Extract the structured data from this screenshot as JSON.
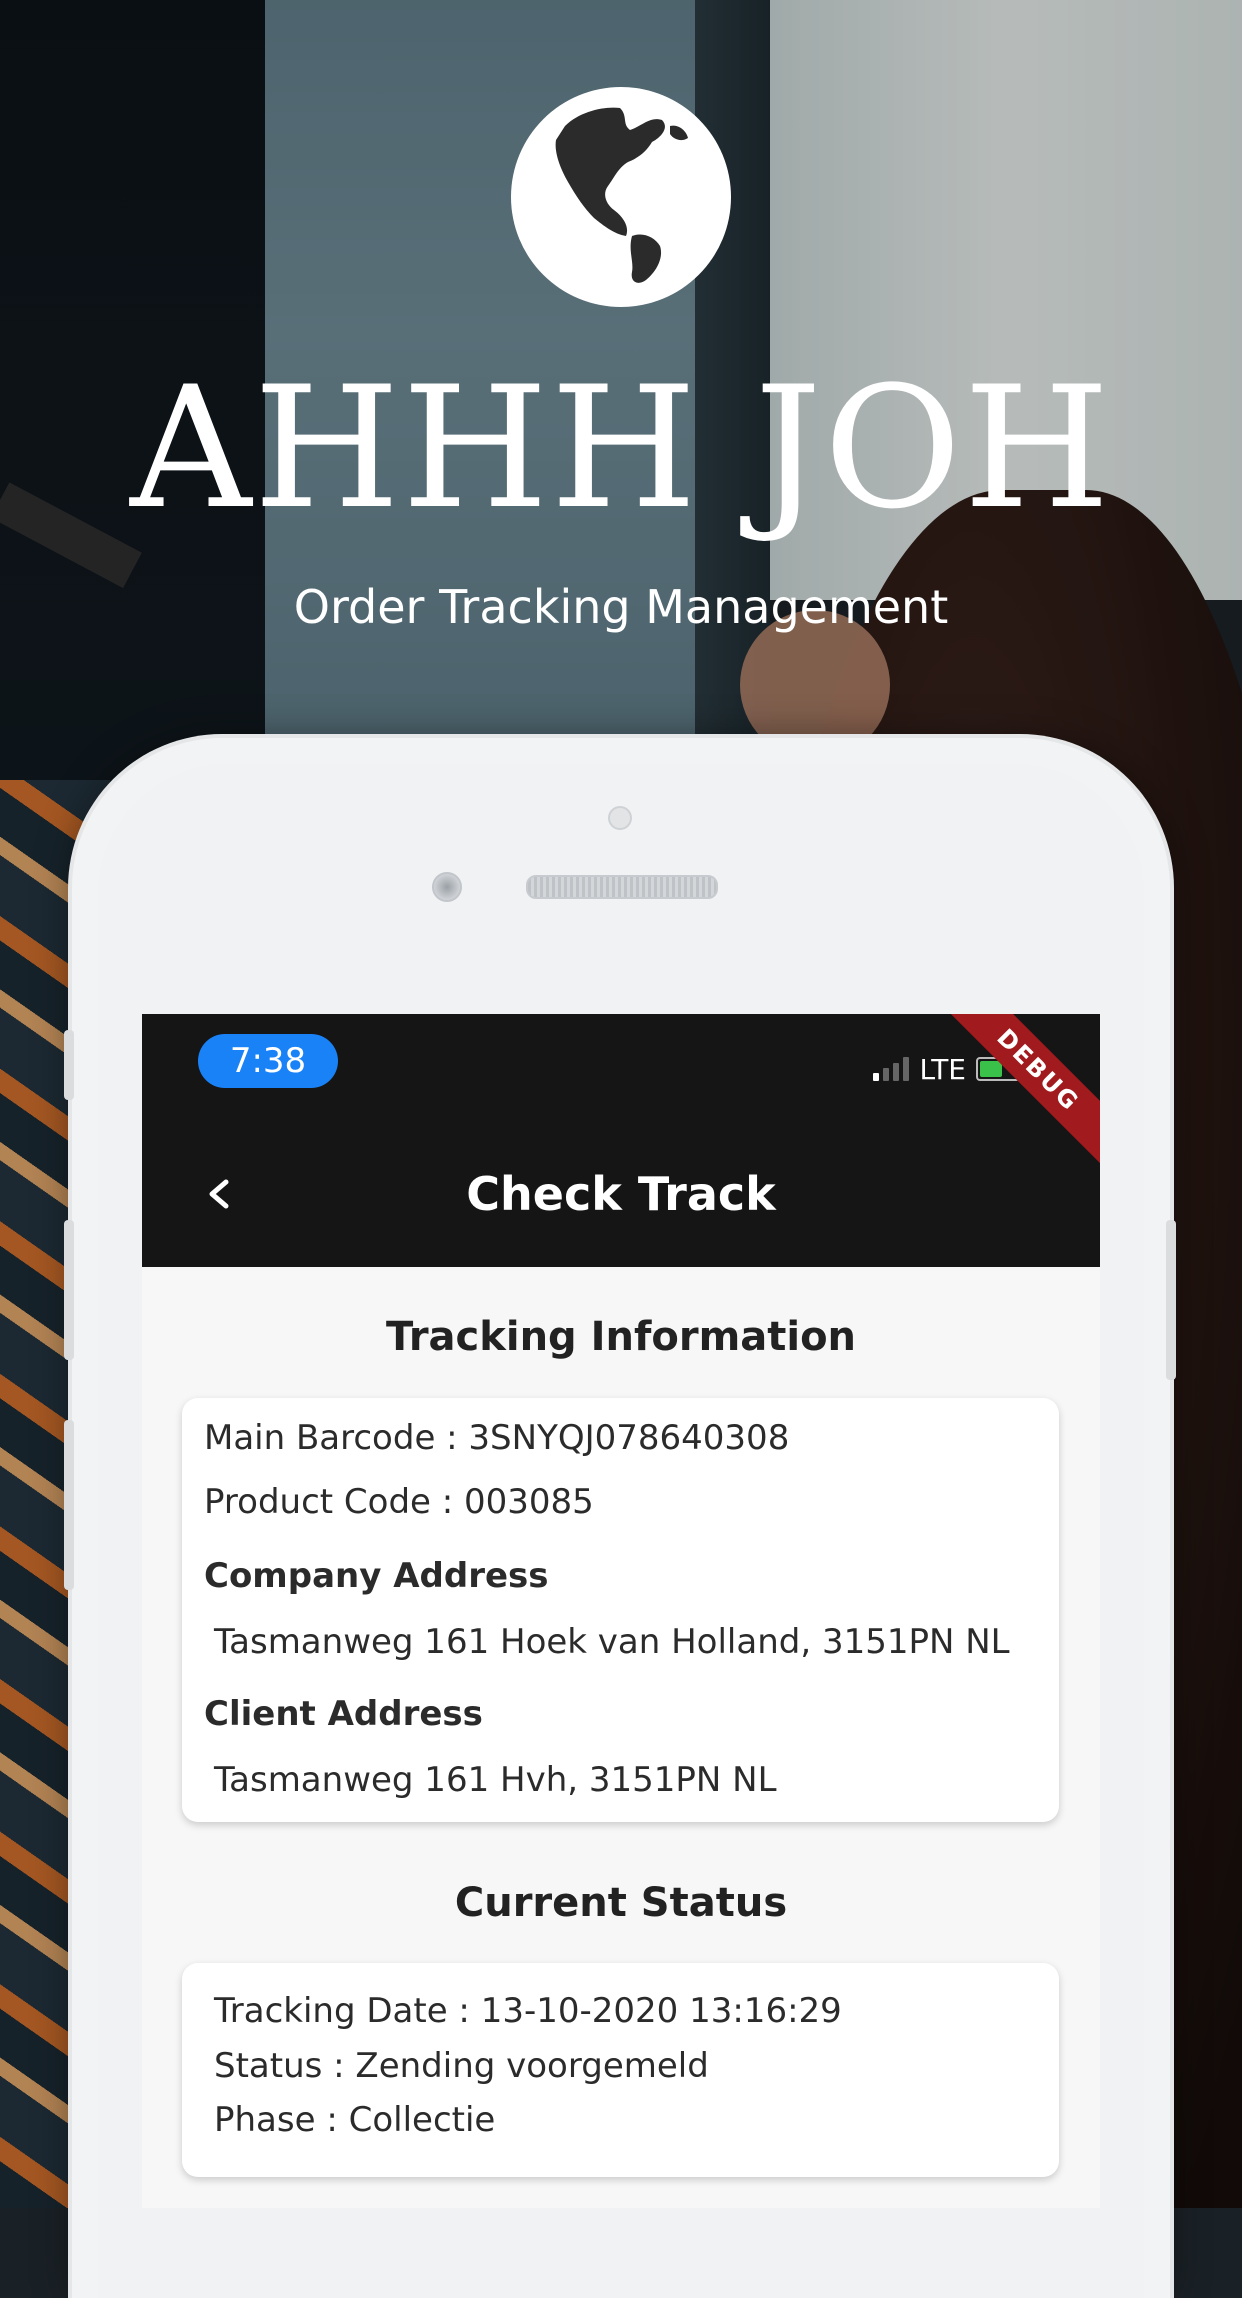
{
  "brand": {
    "title": "AHHH JOH",
    "subtitle": "Order Tracking Management"
  },
  "status_bar": {
    "time": "7:38",
    "network": "LTE",
    "debug_banner": "DEBUG"
  },
  "app_bar": {
    "title": "Check Track",
    "back_icon": "chevron-left-icon"
  },
  "tracking": {
    "heading": "Tracking Information",
    "main_barcode": "Main Barcode : 3SNYQJ078640308",
    "product_code": "Product Code : 003085",
    "company_address_label": "Company Address",
    "company_address": "Tasmanweg 161 Hoek van Holland, 3151PN NL",
    "client_address_label": "Client Address",
    "client_address": "Tasmanweg 161 Hvh, 3151PN NL"
  },
  "current_status": {
    "heading": "Current Status",
    "tracking_date": "Tracking Date : 13-10-2020 13:16:29",
    "status": "Status : Zending voorgemeld",
    "phase": "Phase : Collectie"
  },
  "colors": {
    "app_bar": "#151515",
    "time_pill": "#1a82f7",
    "debug_banner": "#a11a1e"
  }
}
